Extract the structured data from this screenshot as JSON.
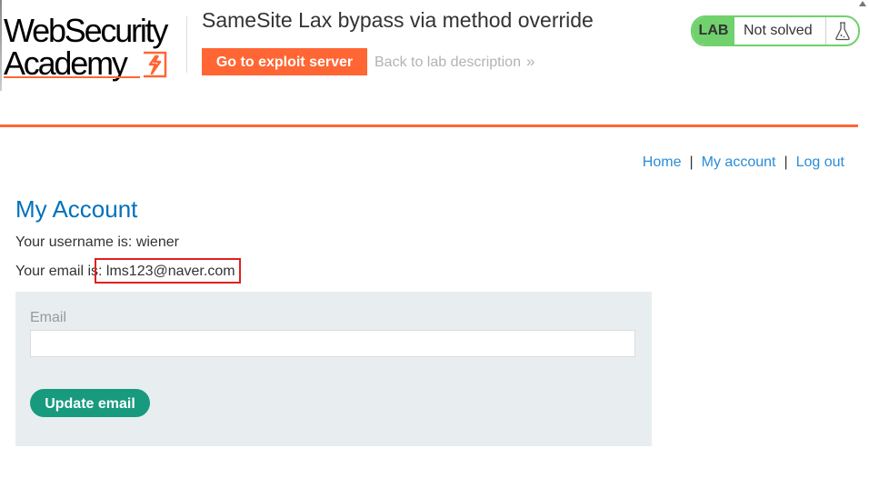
{
  "header": {
    "logo": {
      "line1": "WebSecurity",
      "line2": "Academy"
    },
    "lab_title": "SameSite Lax bypass via method override",
    "exploit_button_label": "Go to exploit server",
    "back_link_label": "Back to lab description",
    "back_link_chevron": "»",
    "lab_status": {
      "badge": "LAB",
      "status_text": "Not solved",
      "icon": "flask-icon"
    }
  },
  "nav": {
    "home": "Home",
    "my_account": "My account",
    "log_out": "Log out",
    "separator": "|"
  },
  "main": {
    "heading": "My Account",
    "username_line": "Your username is: wiener",
    "email_prefix": "Your email is: ",
    "email_value": "lms123@naver.com",
    "form": {
      "email_label": "Email",
      "email_value": "",
      "email_placeholder": "",
      "submit_label": "Update email"
    }
  },
  "colors": {
    "brand_orange": "#ff6633",
    "lab_green": "#70d16d",
    "heading_blue": "#0071bc",
    "link_blue": "#2a8cd8",
    "button_teal": "#189a7f",
    "form_bg": "#e8eef0",
    "highlight_red": "#e02020"
  }
}
